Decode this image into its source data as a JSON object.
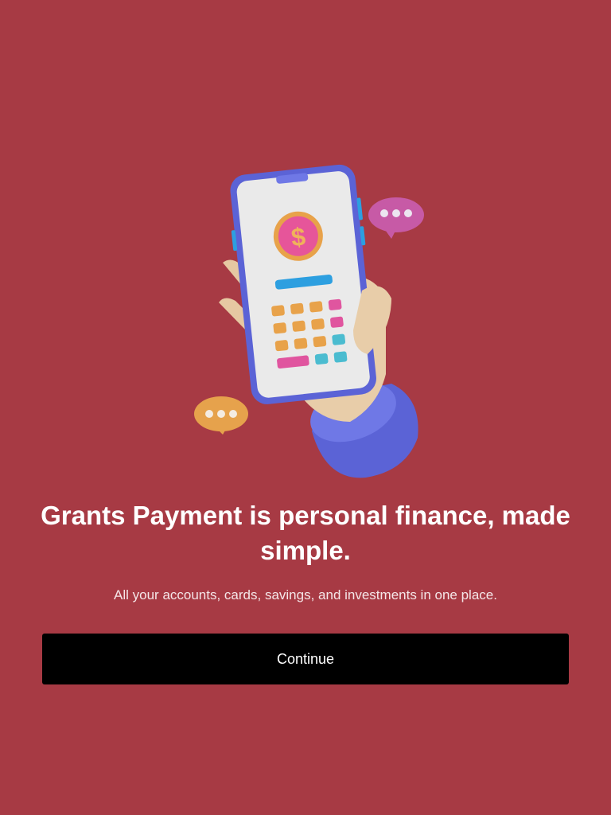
{
  "onboarding": {
    "headline": "Grants Payment is personal finance, made simple.",
    "subtitle": "All your accounts, cards, savings, and investments in one place.",
    "continue_label": "Continue",
    "illustration": {
      "icon": "hand-holding-phone-calculator-icon",
      "coin_symbol": "$"
    }
  },
  "colors": {
    "background": "#a73a44",
    "button": "#000000",
    "text": "#ffffff"
  }
}
